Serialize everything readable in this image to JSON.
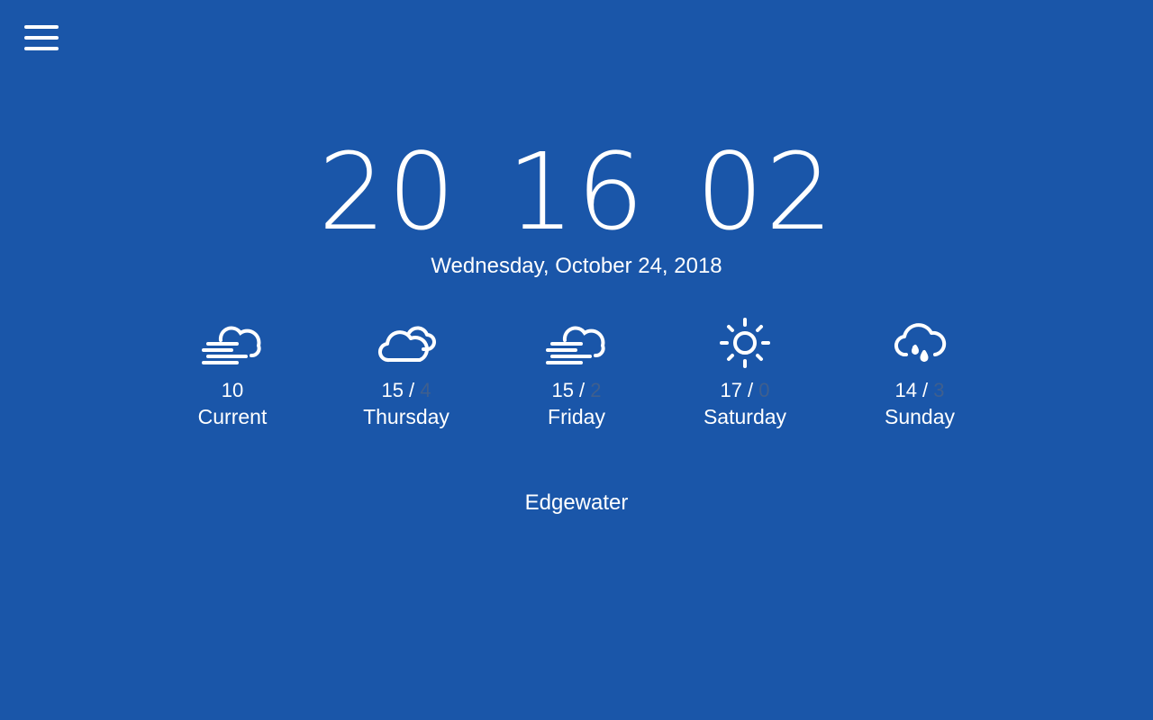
{
  "menu": {
    "icon": "hamburger-menu-icon"
  },
  "clock": {
    "hours": "20",
    "minutes": "16",
    "seconds": "02"
  },
  "date": "Wednesday, October 24, 2018",
  "forecast": [
    {
      "icon": "fog-cloud-icon",
      "high": "10",
      "separator": "",
      "low": "",
      "label": "Current"
    },
    {
      "icon": "clouds-icon",
      "high": "15",
      "separator": " / ",
      "low": "4",
      "label": "Thursday"
    },
    {
      "icon": "fog-cloud-icon",
      "high": "15",
      "separator": " / ",
      "low": "2",
      "label": "Friday"
    },
    {
      "icon": "sun-icon",
      "high": "17",
      "separator": " / ",
      "low": "0",
      "label": "Saturday"
    },
    {
      "icon": "rain-cloud-icon",
      "high": "14",
      "separator": " / ",
      "low": "3",
      "label": "Sunday"
    }
  ],
  "location": "Edgewater",
  "colors": {
    "background": "#1a56a9",
    "text": "#ffffff",
    "low_temp": "#3f5f8e"
  }
}
